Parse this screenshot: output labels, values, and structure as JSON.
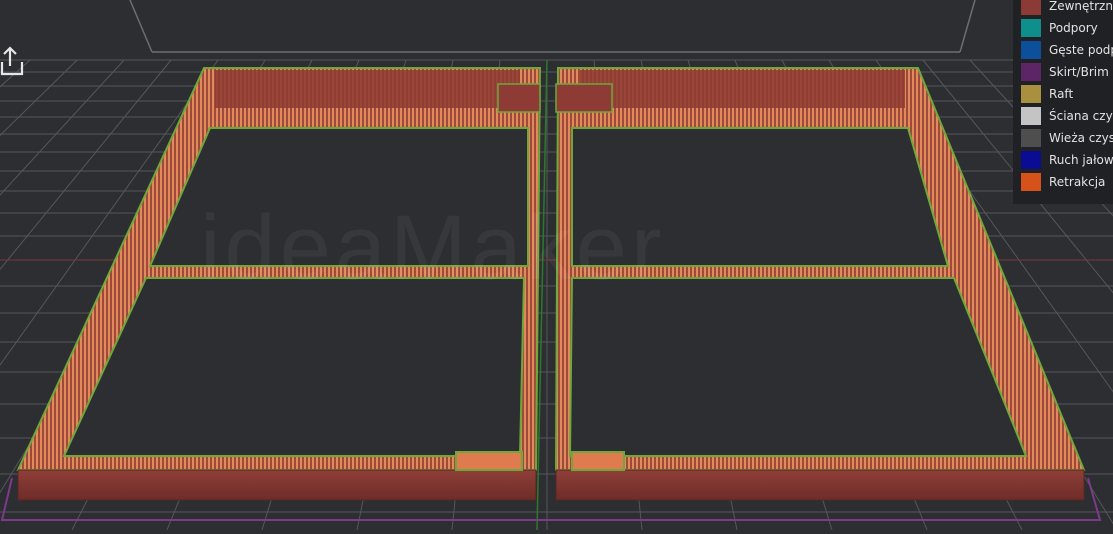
{
  "watermark": "ideaMaker",
  "toolbar": {
    "export_icon": "export-icon"
  },
  "legend": {
    "items": [
      {
        "label": "Zewnętrzna",
        "color": "#8b3a36"
      },
      {
        "label": "Podpory",
        "color": "#0e8f8c"
      },
      {
        "label": "Gęste podp",
        "color": "#0c4f9a"
      },
      {
        "label": "Skirt/Brim",
        "color": "#5b2566"
      },
      {
        "label": "Raft",
        "color": "#a8903e"
      },
      {
        "label": "Ściana czys",
        "color": "#c4c4c4"
      },
      {
        "label": "Wieża czys",
        "color": "#4e4e4e"
      },
      {
        "label": "Ruch jałow",
        "color": "#0a0c93"
      },
      {
        "label": "Retrakcja",
        "color": "#d7511b"
      }
    ]
  },
  "colors": {
    "background": "#2c2e31",
    "grid": "#54575b",
    "outer_wall": "#8b3a36",
    "infill": "#e07a4f",
    "inner_wall": "#6ea83a",
    "skirt": "#7d3a88"
  }
}
